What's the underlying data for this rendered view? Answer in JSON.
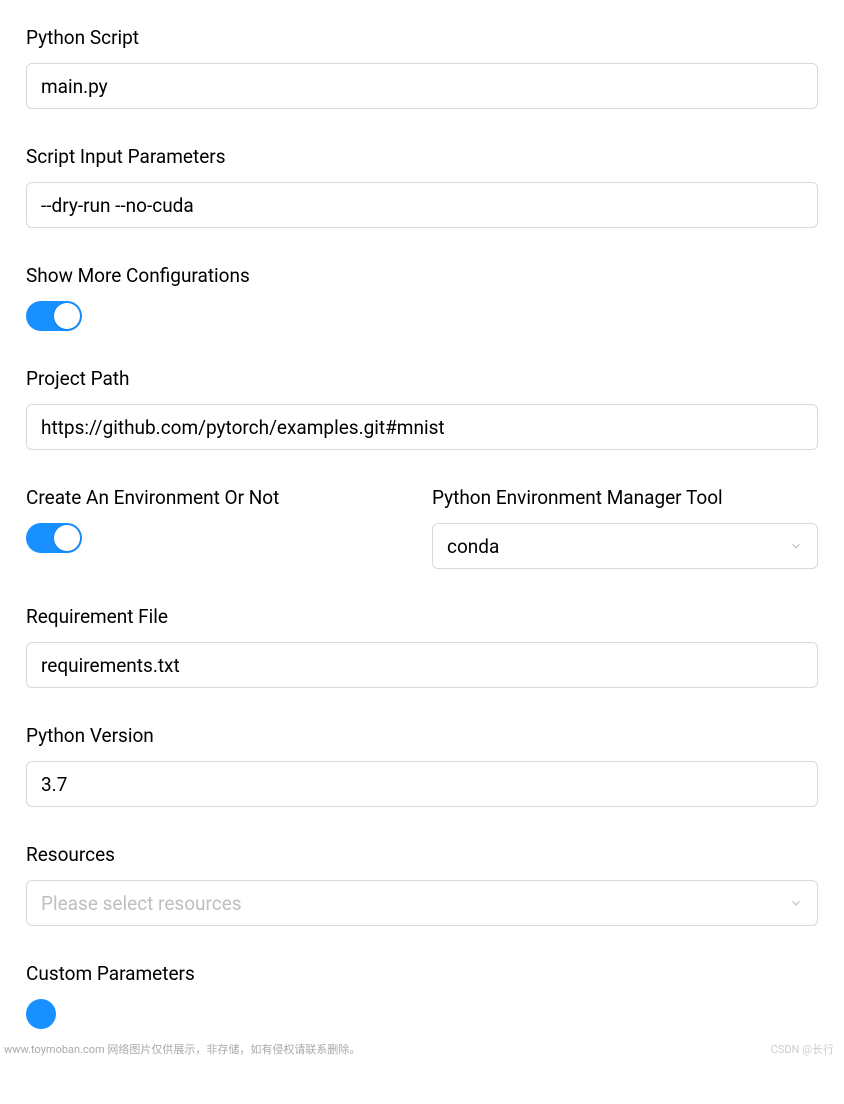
{
  "fields": {
    "python_script": {
      "label": "Python Script",
      "value": "main.py"
    },
    "script_input_parameters": {
      "label": "Script Input Parameters",
      "value": "--dry-run --no-cuda"
    },
    "show_more_configurations": {
      "label": "Show More Configurations",
      "toggle_on": true
    },
    "project_path": {
      "label": "Project Path",
      "value": "https://github.com/pytorch/examples.git#mnist"
    },
    "create_environment": {
      "label": "Create An Environment Or Not",
      "toggle_on": true
    },
    "python_env_manager": {
      "label": "Python Environment Manager Tool",
      "value": "conda"
    },
    "requirement_file": {
      "label": "Requirement File",
      "value": "requirements.txt"
    },
    "python_version": {
      "label": "Python Version",
      "value": "3.7"
    },
    "resources": {
      "label": "Resources",
      "placeholder": "Please select resources"
    },
    "custom_parameters": {
      "label": "Custom Parameters"
    }
  },
  "watermark": {
    "left": "www.toymoban.com 网络图片仅供展示，非存储，如有侵权请联系删除。",
    "right": "CSDN @长行"
  }
}
